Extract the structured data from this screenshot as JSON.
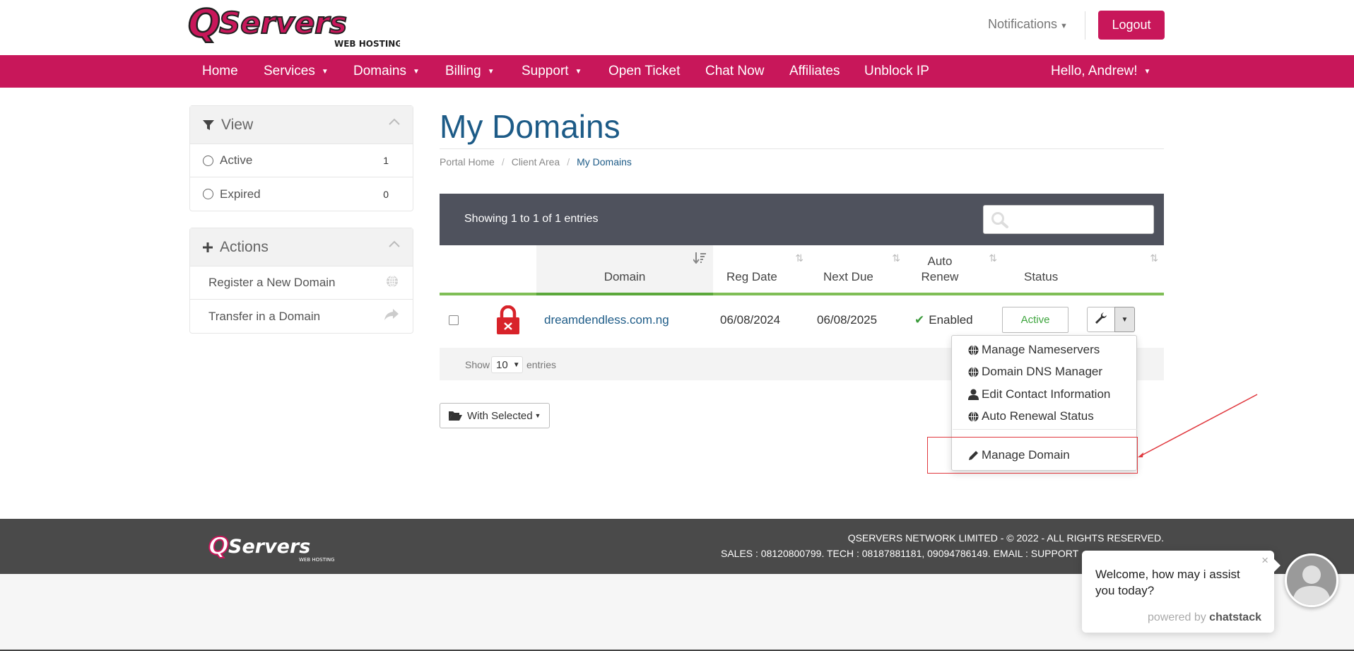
{
  "brand": {
    "logo_text": "QServers",
    "logo_sub": "WEB HOSTING",
    "accent": "#c8175a",
    "title_color": "#1d5b87"
  },
  "header": {
    "notifications": "Notifications",
    "logout": "Logout"
  },
  "nav": {
    "home": "Home",
    "services": "Services",
    "domains": "Domains",
    "billing": "Billing",
    "support": "Support",
    "open_ticket": "Open Ticket",
    "chat_now": "Chat Now",
    "affiliates": "Affiliates",
    "unblock_ip": "Unblock IP",
    "user": "Hello, Andrew!"
  },
  "sidebar": {
    "view": {
      "title": "View",
      "items": [
        {
          "label": "Active",
          "count": "1"
        },
        {
          "label": "Expired",
          "count": "0"
        }
      ]
    },
    "actions": {
      "title": "Actions",
      "items": [
        {
          "label": "Register a New Domain",
          "icon": "globe-icon"
        },
        {
          "label": "Transfer in a Domain",
          "icon": "share-icon"
        }
      ]
    }
  },
  "main": {
    "title": "My Domains",
    "breadcrumb": [
      "Portal Home",
      "Client Area",
      "My Domains"
    ],
    "entries_info": "Showing 1 to 1 of 1 entries",
    "columns": {
      "domain": "Domain",
      "reg_date": "Reg Date",
      "next_due": "Next Due",
      "auto_renew": "Auto Renew",
      "status": "Status"
    },
    "rows": [
      {
        "domain": "dreamdendless.com.ng",
        "reg_date": "06/08/2024",
        "next_due": "06/08/2025",
        "auto_renew": "Enabled",
        "status": "Active"
      }
    ],
    "show_label": "Show",
    "page_size": "10",
    "entries_label": "entries",
    "with_selected": "With Selected"
  },
  "dropdown": {
    "items": [
      {
        "label": "Manage Nameservers",
        "icon": "globe-icon"
      },
      {
        "label": "Domain DNS Manager",
        "icon": "globe-icon"
      },
      {
        "label": "Edit Contact Information",
        "icon": "user-icon"
      },
      {
        "label": "Auto Renewal Status",
        "icon": "globe-icon"
      },
      {
        "label": "Manage Domain",
        "icon": "pencil-icon"
      }
    ]
  },
  "footer": {
    "copyright": "QSERVERS NETWORK LIMITED - © 2022 - ALL RIGHTS RESERVED.",
    "contact": "SALES : 08120800799. TECH : 08187881181, 09094786149. EMAIL : SUPPORT"
  },
  "chat": {
    "message": "Welcome, how may i assist you today?",
    "powered_by": "powered by",
    "brand": "chatstack",
    "close": "×"
  }
}
